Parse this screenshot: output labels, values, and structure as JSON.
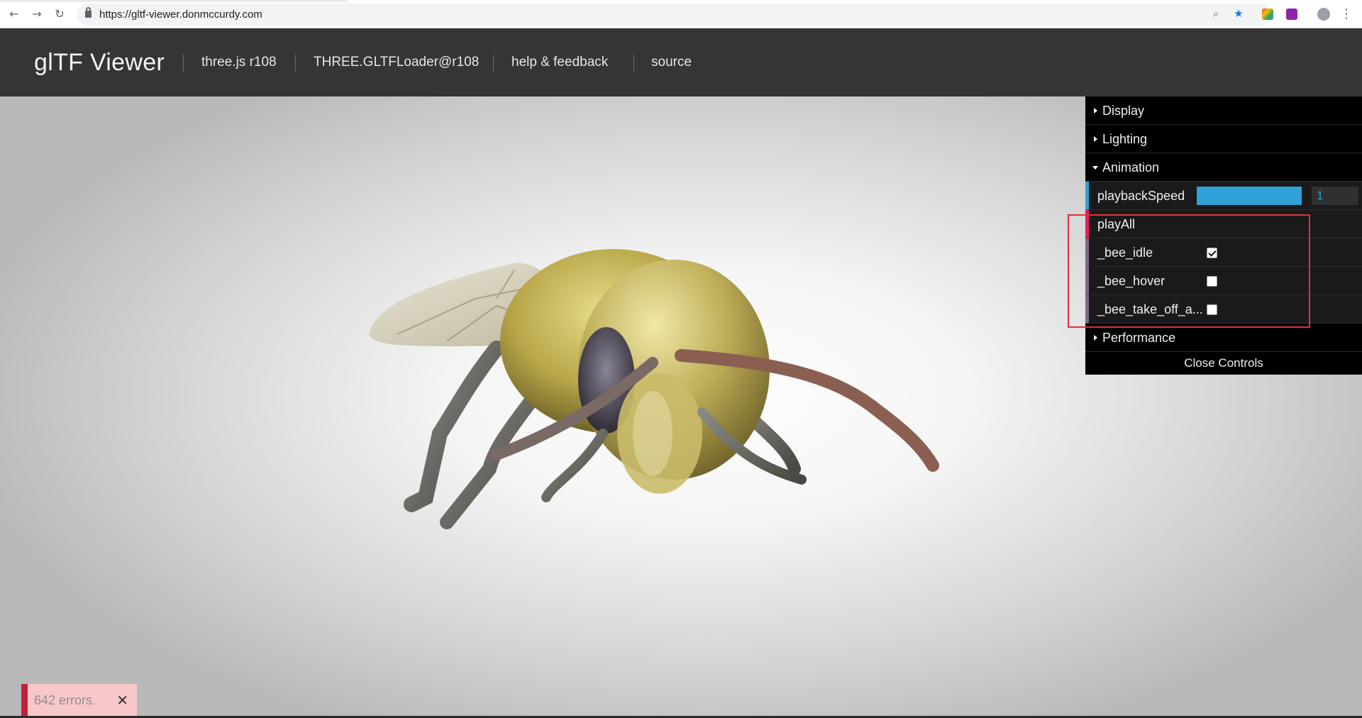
{
  "browser": {
    "url": "https://gltf-viewer.donmccurdy.com",
    "back_glyph": "←",
    "forward_glyph": "→",
    "reload_glyph": "↻",
    "zoom_glyph": "⌕",
    "star_glyph": "★",
    "menu_glyph": "⋮"
  },
  "header": {
    "brand": "glTF Viewer",
    "nav": [
      "three.js r108",
      "THREE.GLTFLoader@r108",
      "help & feedback",
      "source"
    ]
  },
  "gui": {
    "folders": {
      "display": "Display",
      "lighting": "Lighting",
      "animation": "Animation",
      "performance": "Performance"
    },
    "playback_speed": {
      "label": "playbackSpeed",
      "value": "1",
      "fill_fraction": 1.0
    },
    "play_all": "playAll",
    "clips": [
      {
        "label": "_bee_idle",
        "checked": true
      },
      {
        "label": "_bee_hover",
        "checked": false
      },
      {
        "label": "_bee_take_off_a...",
        "checked": false
      }
    ],
    "close_controls": "Close Controls"
  },
  "error": {
    "message": "642 errors.",
    "close_glyph": "✕"
  },
  "colors": {
    "header_bg": "#353535",
    "gui_accent": "#2fa1d6",
    "gui_function": "#e61d5f",
    "gui_boolean": "#806787",
    "highlight": "#e0313c",
    "error_bg": "#f8c8c8",
    "error_bar": "#c21f3b"
  }
}
